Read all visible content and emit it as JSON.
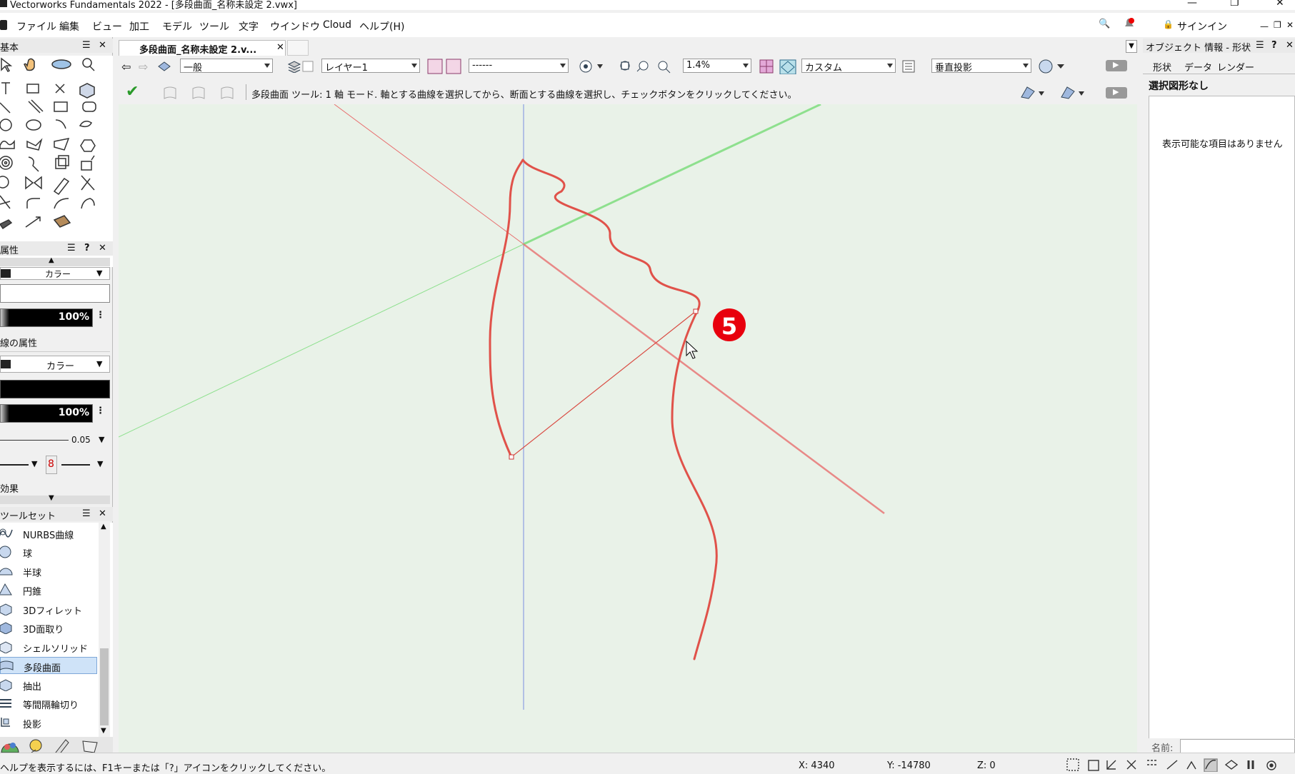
{
  "window": {
    "title": "Vectorworks Fundamentals 2022 - [多段曲面_名称未設定 2.vwx]"
  },
  "menu": {
    "items": [
      "ファイル",
      "編集",
      "ビュー",
      "加工",
      "モデル",
      "ツール",
      "文字",
      "ウインドウ",
      "Cloud",
      "ヘルプ(H)"
    ],
    "signin": "サインイン"
  },
  "basic_palette": {
    "title": "基本"
  },
  "attributes": {
    "title": "属性",
    "fill_type": "カラー",
    "fill_opacity": "100%",
    "line_title": "線の属性",
    "line_type": "カラー",
    "line_opacity": "100%",
    "line_weight": "0.05",
    "effects_title": "効果"
  },
  "toolset": {
    "title": "ツールセット",
    "items": [
      {
        "label": "NURBS曲線",
        "icon": "nurbs-curve-icon"
      },
      {
        "label": "球",
        "icon": "sphere-icon"
      },
      {
        "label": "半球",
        "icon": "hemisphere-icon"
      },
      {
        "label": "円錐",
        "icon": "cone-icon"
      },
      {
        "label": "3Dフィレット",
        "icon": "fillet-3d-icon"
      },
      {
        "label": "3D面取り",
        "icon": "chamfer-3d-icon"
      },
      {
        "label": "シェルソリッド",
        "icon": "shell-solid-icon"
      },
      {
        "label": "多段曲面",
        "icon": "loft-surface-icon",
        "selected": true
      },
      {
        "label": "抽出",
        "icon": "extract-icon"
      },
      {
        "label": "等間隔輪切り",
        "icon": "contour-icon"
      },
      {
        "label": "投影",
        "icon": "project-icon"
      }
    ]
  },
  "document": {
    "tab_label": "多段曲面_名称未設定 2.v...",
    "close": "✕"
  },
  "view_bar": {
    "class_value": "一般",
    "layer_value": "レイヤー1",
    "viewport_value": "------",
    "zoom_value": "1.4%",
    "render_value": "カスタム",
    "projection_value": "垂直投影"
  },
  "mode_bar": {
    "message": "多段曲面 ツール: 1 軸 モード. 軸とする曲線を選択してから、断面とする曲線を選択し、チェックボタンをクリックしてください。"
  },
  "canvas": {
    "marker": "5"
  },
  "obj_info": {
    "title": "オブジェクト 情報 - 形状",
    "tabs": [
      "形状",
      "データ",
      "レンダー"
    ],
    "selection": "選択図形なし",
    "empty_message": "表示可能な項目はありません",
    "name_label": "名前:"
  },
  "status": {
    "help": "ヘルプを表示するには、F1キーまたは「?」アイコンをクリックしてください。",
    "x": "X: 4340",
    "y": "Y: -14780",
    "z": "Z: 0"
  },
  "colors": {
    "canvas_bg": "#e9f2e8",
    "curve": "#e0524a",
    "axis_green": "#8ee08e",
    "axis_red": "#e86f6f",
    "axis_blue": "#7b8fe0",
    "badge": "#e8000d",
    "selected_item": "#cfe3f8"
  }
}
